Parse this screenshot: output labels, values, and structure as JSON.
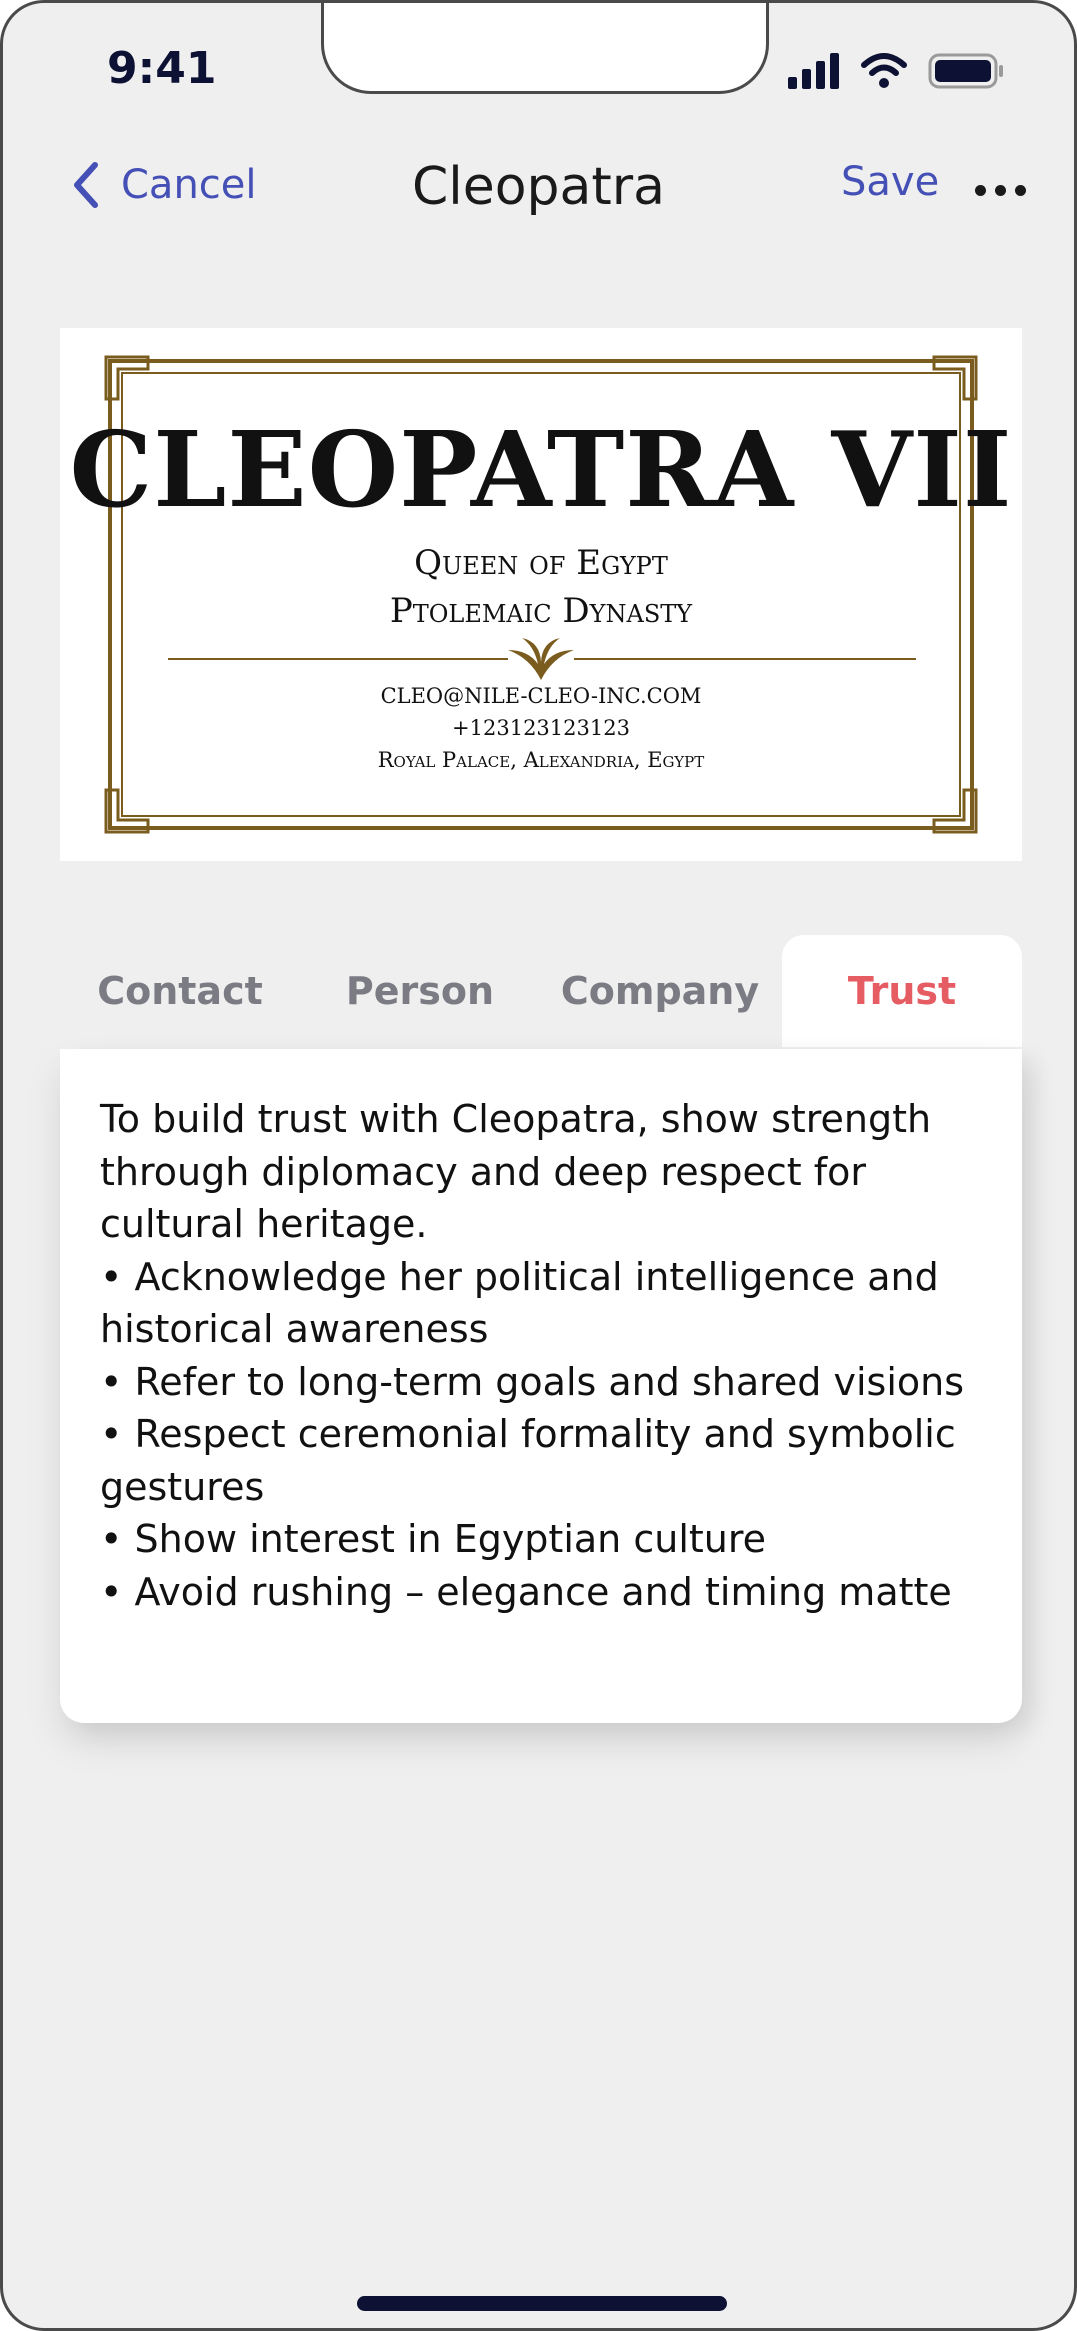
{
  "status_bar": {
    "time": "9:41"
  },
  "nav": {
    "cancel_label": "Cancel",
    "title": "Cleopatra",
    "save_label": "Save"
  },
  "business_card": {
    "name": "CLEOPATRA VII",
    "title_line_1": "Queen of Egypt",
    "title_line_2": "Ptolemaic Dynasty",
    "email": "CLEO@NILE-CLEO-INC.COM",
    "phone": "+123123123123",
    "address": "Royal Palace, Alexandria, Egypt",
    "accent_color": "#7a5c1e"
  },
  "tabs": [
    {
      "label": "Contact",
      "active": false
    },
    {
      "label": "Person",
      "active": false
    },
    {
      "label": "Company",
      "active": false
    },
    {
      "label": "Trust",
      "active": true
    }
  ],
  "trust": {
    "text": "To build trust with Cleopatra, show strength through diplomacy and deep respect for cultural heritage.\n• Acknowledge her political intelligence and historical awareness\n• Refer to long-term goals and shared visions\n• Respect ceremonial formality and symbolic gestures\n• Show interest in Egyptian culture\n• Avoid rushing – elegance and timing matte"
  },
  "colors": {
    "accent": "#4450b5",
    "active_tab": "#e55c63",
    "background": "#efefef"
  }
}
